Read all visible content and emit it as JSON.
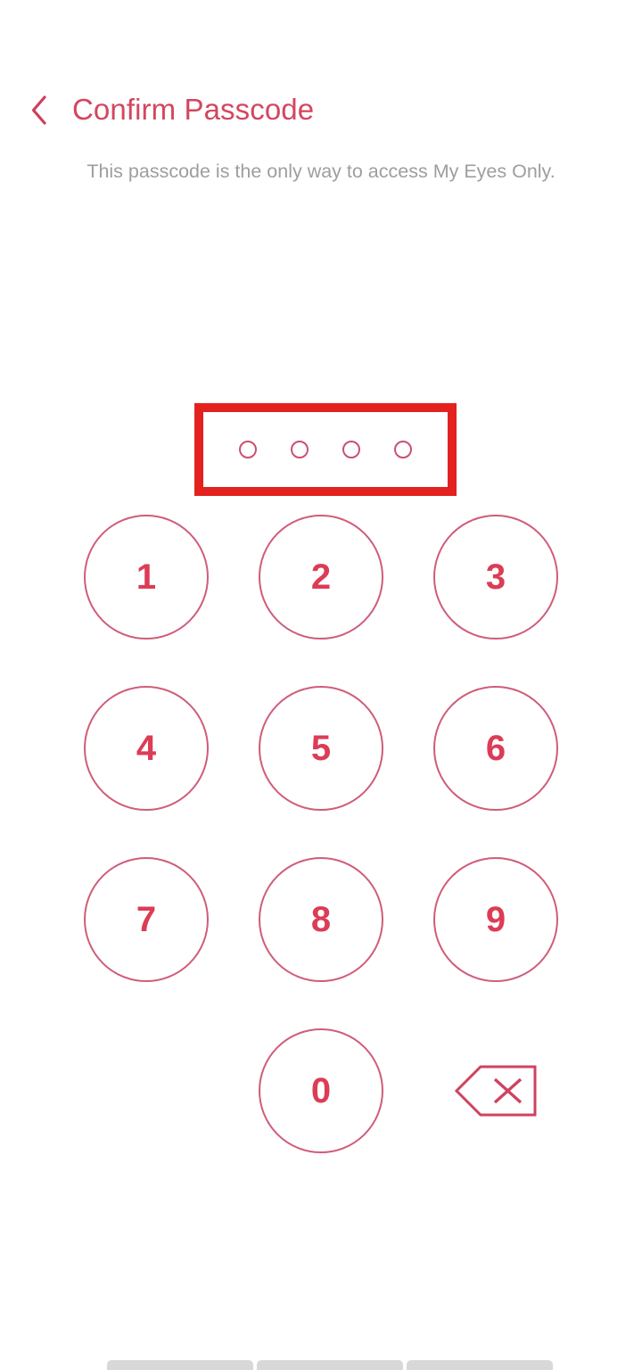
{
  "screen": {
    "name": "confirm-passcode",
    "background": "#ffffff"
  },
  "header": {
    "back_icon": "chevron-left-icon",
    "title": "Confirm Passcode"
  },
  "subtitle": {
    "text": "This passcode is the only way to access My Eyes Only."
  },
  "passcode": {
    "length": 4,
    "entered": 0,
    "dots": [
      {
        "filled": false
      },
      {
        "filled": false
      },
      {
        "filled": false
      },
      {
        "filled": false
      }
    ],
    "highlight": {
      "visible": true,
      "color": "#e3211e",
      "border_width": "10px"
    }
  },
  "keypad": {
    "rows": [
      {
        "keys": [
          "1",
          "2",
          "3"
        ]
      },
      {
        "keys": [
          "4",
          "5",
          "6"
        ]
      },
      {
        "keys": [
          "7",
          "8",
          "9"
        ]
      }
    ],
    "last_row": {
      "zero": "0",
      "backspace_icon": "backspace-delete-icon"
    }
  },
  "nav_bar": {
    "segments": 3,
    "color": "#d8d8d8"
  },
  "colors": {
    "title": "#d4465f",
    "subtitle": "#9e9e9e",
    "key_text": "#dc3c55",
    "key_border": "#cf5d78",
    "dot_border": "#c95070",
    "highlight": "#e3211e",
    "nav_bar": "#d8d8d8"
  }
}
